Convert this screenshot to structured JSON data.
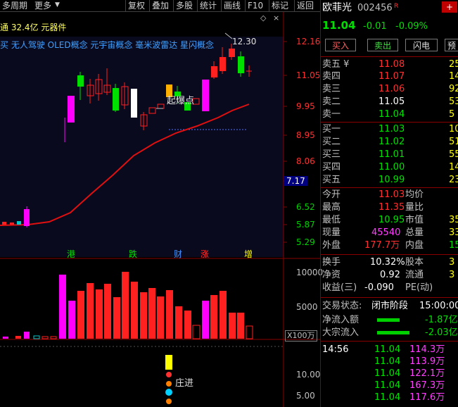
{
  "toolbar": {
    "items": [
      "多周期",
      "更多",
      "复权",
      "叠加",
      "多股",
      "统计",
      "画线",
      "F10",
      "标记",
      "返回"
    ]
  },
  "chart": {
    "header_text": "通 32.4亿 元器件",
    "concepts": "买 无人驾驶 OLED概念 元宇宙概念 毫米波雷达 星闪概念",
    "peak_label": "12.30",
    "annotation": "起爆点",
    "price_axis": [
      "12.16",
      "11.05",
      "9.95",
      "8.95",
      "8.06",
      "7.17",
      "6.52",
      "5.87",
      "5.29"
    ],
    "event_markers": [
      {
        "label": "港",
        "color": "#00e000"
      },
      {
        "label": "跌",
        "color": "#00e000"
      },
      {
        "label": "财",
        "color": "#4090ff"
      },
      {
        "label": "涨",
        "color": "#ff3030"
      },
      {
        "label": "增",
        "color": "#ffff00"
      }
    ],
    "volume_axis": [
      "10000",
      "5000"
    ],
    "volume_unit": "X100万",
    "indicator_axis": [
      "10.00",
      "5.00"
    ],
    "indicator_label": "庄进",
    "colors": {
      "up": "#ff2020",
      "down": "#00c8c8",
      "ma": "#e01010",
      "magenta": "#ff00ff"
    }
  },
  "quote": {
    "name": "欧菲光",
    "code": "002456",
    "tag": "R",
    "price": "11.04",
    "change": "-0.01",
    "change_pct": "-0.09%",
    "buttons": [
      "买入",
      "卖出",
      "闪电"
    ],
    "buttons_extra": "预",
    "sells": [
      {
        "label": "卖五 ¥",
        "price": "11.08",
        "vol": "25"
      },
      {
        "label": "卖四",
        "price": "11.07",
        "vol": "14"
      },
      {
        "label": "卖三",
        "price": "11.06",
        "vol": "92"
      },
      {
        "label": "卖二",
        "price": "11.05",
        "vol": "53"
      },
      {
        "label": "卖一",
        "price": "11.04",
        "vol": "5"
      }
    ],
    "buys": [
      {
        "label": "买一",
        "price": "11.03",
        "vol": "10"
      },
      {
        "label": "买二",
        "price": "11.02",
        "vol": "51"
      },
      {
        "label": "买三",
        "price": "11.01",
        "vol": "55"
      },
      {
        "label": "买四",
        "price": "11.00",
        "vol": "14"
      },
      {
        "label": "买五",
        "price": "10.99",
        "vol": "23"
      }
    ],
    "stats": [
      {
        "l1": "今开",
        "v1": "11.03",
        "l2": "均价",
        "v2": ""
      },
      {
        "l1": "最高",
        "v1": "11.35",
        "l2": "量比",
        "v2": ""
      },
      {
        "l1": "最低",
        "v1": "10.95",
        "l2": "市值",
        "v2": "35"
      },
      {
        "l1": "现量",
        "v1": "45540",
        "l2": "总量",
        "v2": "33"
      },
      {
        "l1": "外盘",
        "v1": "177.7万",
        "l2": "内盘",
        "v2": "15"
      }
    ],
    "stats2": [
      {
        "l1": "换手",
        "v1": "10.32%",
        "l2": "股本",
        "v2": "3"
      },
      {
        "l1": "净资",
        "v1": "0.92",
        "l2": "流通",
        "v2": "3"
      },
      {
        "l1": "收益(三)",
        "v1": "-0.090",
        "l2": "PE(动)",
        "v2": ""
      }
    ],
    "status_label": "交易状态:",
    "status_value": "闭市阶段",
    "status_time": "15:00:00",
    "flows": [
      {
        "label": "净流入额",
        "value": "-1.87亿"
      },
      {
        "label": "大宗流入",
        "value": "-2.03亿"
      }
    ],
    "ticks": [
      {
        "time": "14:56",
        "price": "11.04",
        "vol": "114.3万"
      },
      {
        "time": "",
        "price": "11.04",
        "vol": "113.9万"
      },
      {
        "time": "",
        "price": "11.04",
        "vol": "122.1万"
      },
      {
        "time": "",
        "price": "11.04",
        "vol": "167.3万"
      },
      {
        "time": "",
        "price": "11.04",
        "vol": "117.6万"
      }
    ]
  }
}
